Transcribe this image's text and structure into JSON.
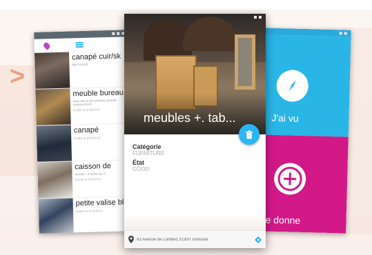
{
  "colors": {
    "accent_blue": "#29b6e6",
    "accent_magenta": "#d31888",
    "fab_blue": "#29b6f6"
  },
  "left_screen": {
    "items": [
      {
        "title": "canapé cuir/sk",
        "desc": "bleu accord",
        "date": ""
      },
      {
        "title": "meuble bureau",
        "desc": "bois clair et pin prêtemo grande · sortiere tiroirs",
        "date": "Publié le 6/29/2016"
      },
      {
        "title": "canapé",
        "desc": "",
        "date": "Publié le 6/29/2016"
      },
      {
        "title": "caisson de",
        "desc": "bureau · 3 tiroirs sur 8",
        "date": "Publié le 6/29/2016"
      },
      {
        "title": "petite valise bleue",
        "desc": "",
        "date": "Publié le 6/29/2016"
      }
    ]
  },
  "center_screen": {
    "title": "meubles +. tab...",
    "category_label": "Catégorie",
    "category_value": "FURNITURE",
    "state_label": "État",
    "state_value": "GOOD",
    "address": "93 Avenue de Lombez 31300 Toulouse"
  },
  "right_screen": {
    "seen_label": "J'ai vu",
    "give_label": "Je donne"
  },
  "icons": {
    "arrow": "chevron-right-icon",
    "logo": "pin-logo-icon",
    "menu": "hamburger-icon",
    "delete": "trash-icon",
    "location": "location-pin-icon",
    "directions": "directions-icon",
    "compass": "compass-icon",
    "add": "plus-circle-icon"
  }
}
